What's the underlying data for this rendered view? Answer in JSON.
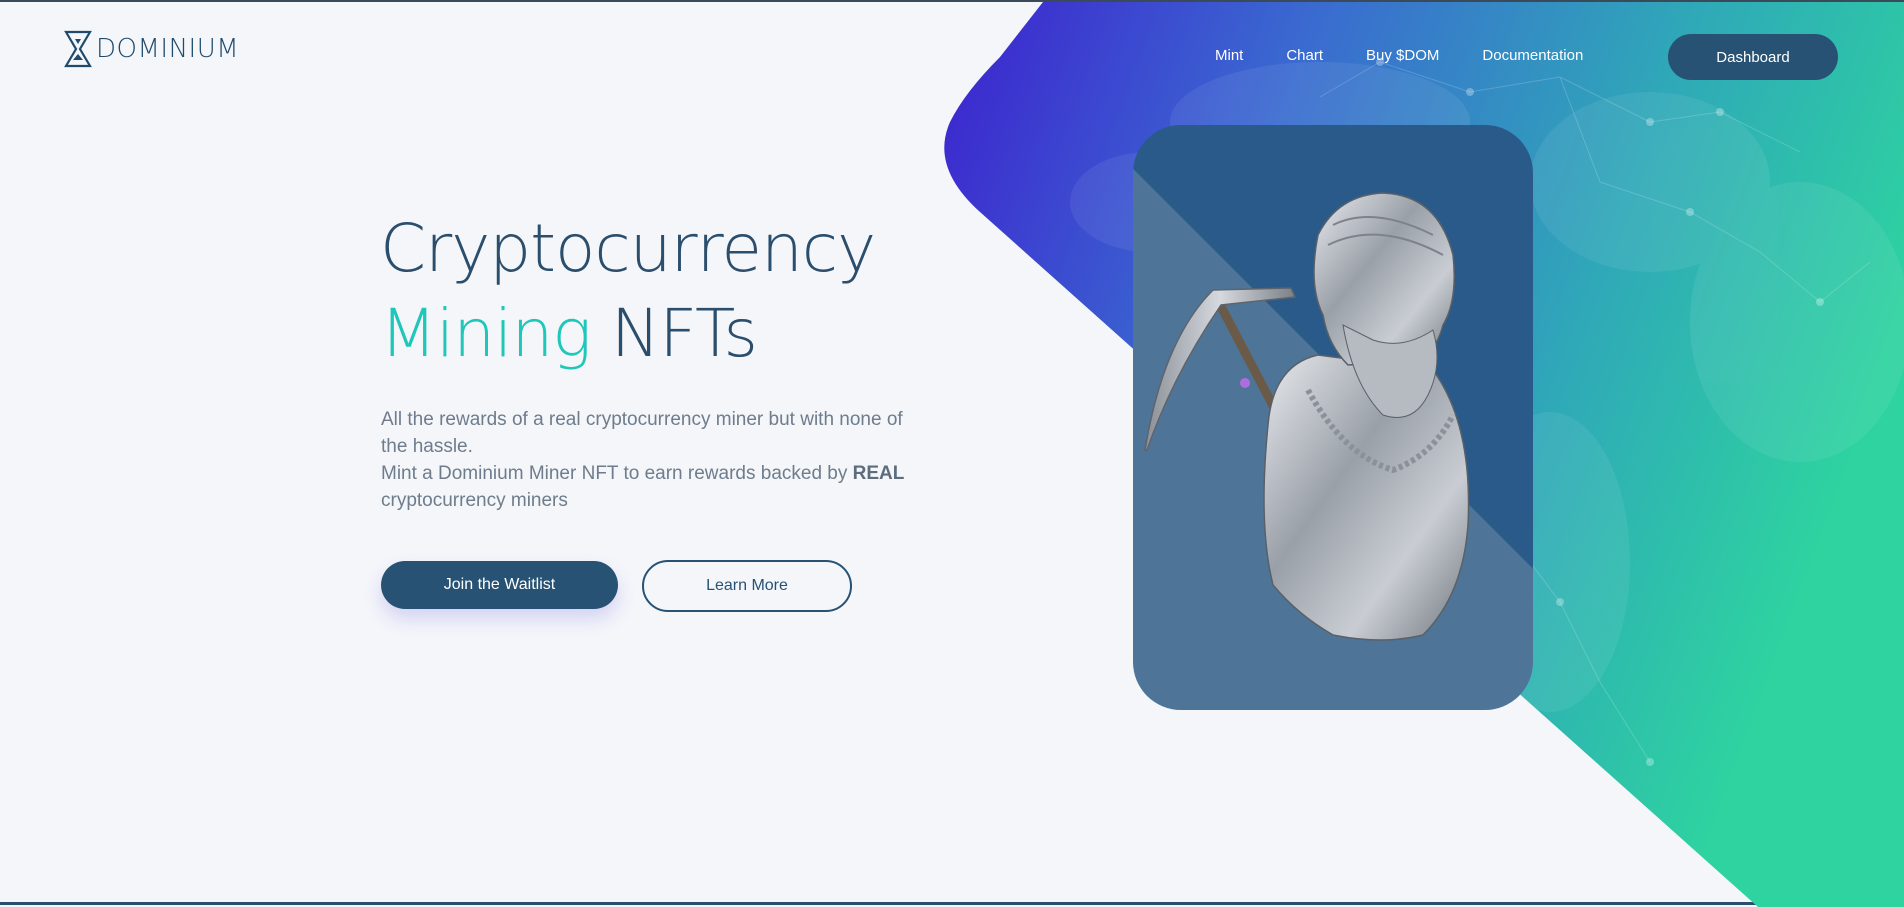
{
  "brand": {
    "name": "DOMINIUM",
    "logo_icon": "hourglass-logo-icon"
  },
  "nav": {
    "items": [
      {
        "label": "Mint"
      },
      {
        "label": "Chart"
      },
      {
        "label": "Buy $DOM"
      },
      {
        "label": "Documentation"
      }
    ],
    "dashboard_label": "Dashboard"
  },
  "hero": {
    "title_line1": "Cryptocurrency",
    "title_accent": "Mining",
    "title_rest": "NFTs",
    "description_line1": "All the rewards of a real cryptocurrency miner but with none of the hassle.",
    "description_line2_start": "Mint a Dominium Miner NFT to earn rewards backed by",
    "description_line2_bold": "REAL",
    "description_line2_end": "cryptocurrency miners",
    "primary_button": "Join the Waitlist",
    "secondary_button": "Learn More"
  },
  "artwork": {
    "icon": "bearded-miner-bust-with-pickaxe"
  },
  "colors": {
    "primary": "#275273",
    "accent": "#1ec7b9",
    "gradient_start": "#3d22cf",
    "gradient_end": "#2ed3a0",
    "background": "#f4f6fa"
  }
}
